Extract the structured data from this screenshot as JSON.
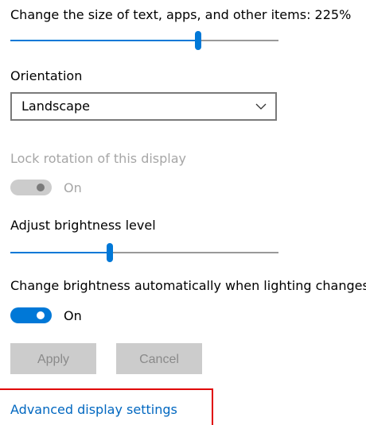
{
  "scale": {
    "label": "Change the size of text, apps, and other items: 225%",
    "slider_level_percent": 70
  },
  "orientation": {
    "label": "Orientation",
    "selected": "Landscape"
  },
  "lock_rotation": {
    "label": "Lock rotation of this display",
    "state": "On",
    "enabled": false
  },
  "brightness": {
    "label": "Adjust brightness level",
    "slider_level_percent": 37
  },
  "auto_brightness": {
    "label": "Change brightness automatically when lighting changes",
    "state": "On"
  },
  "actions": {
    "apply_label": "Apply",
    "cancel_label": "Cancel"
  },
  "advanced": {
    "link_label": "Advanced display settings"
  },
  "colors": {
    "accent": "#0078d7",
    "link": "#0067c0",
    "disabled_text": "#a6a6a6",
    "highlight_box": "#e00000"
  },
  "icons": {
    "dropdown": "chevron-down-icon"
  }
}
